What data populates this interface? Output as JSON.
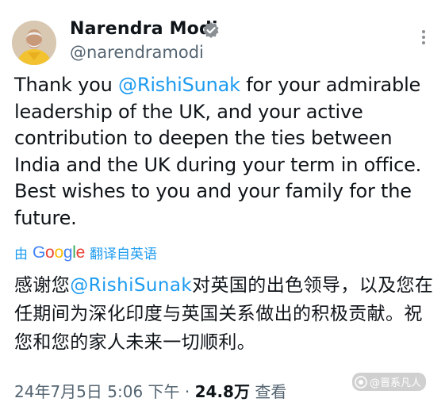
{
  "author": {
    "display_name": "Narendra Modi",
    "handle": "@narendramodi",
    "avatar_icon": "profile-photo",
    "verified_icon": "verified-badge-icon",
    "verified_color": "#8a8f94"
  },
  "tweet": {
    "text_before": "Thank you ",
    "mention": "@RishiSunak",
    "text_after": " for your admirable leadership of the UK, and your active contribution to deepen the ties between India and the UK during your term in office. Best wishes to you and your family for the future.",
    "mention_color": "#1d9bf0"
  },
  "translation": {
    "prefix": "由",
    "provider": "Google",
    "suffix": "翻译自英语",
    "text_before": "感谢您",
    "mention": "@RishiSunak",
    "text_after": "对英国的出色领导，以及您在任期间为深化印度与英国关系做出的积极贡献。祝您和您的家人未来一切顺利。"
  },
  "meta": {
    "date": "24年7月5日",
    "time": "5:06 下午",
    "separator": "·",
    "views_count": "24.8万",
    "views_label": "查看"
  },
  "watermark": {
    "text": "@晋系凡人"
  }
}
